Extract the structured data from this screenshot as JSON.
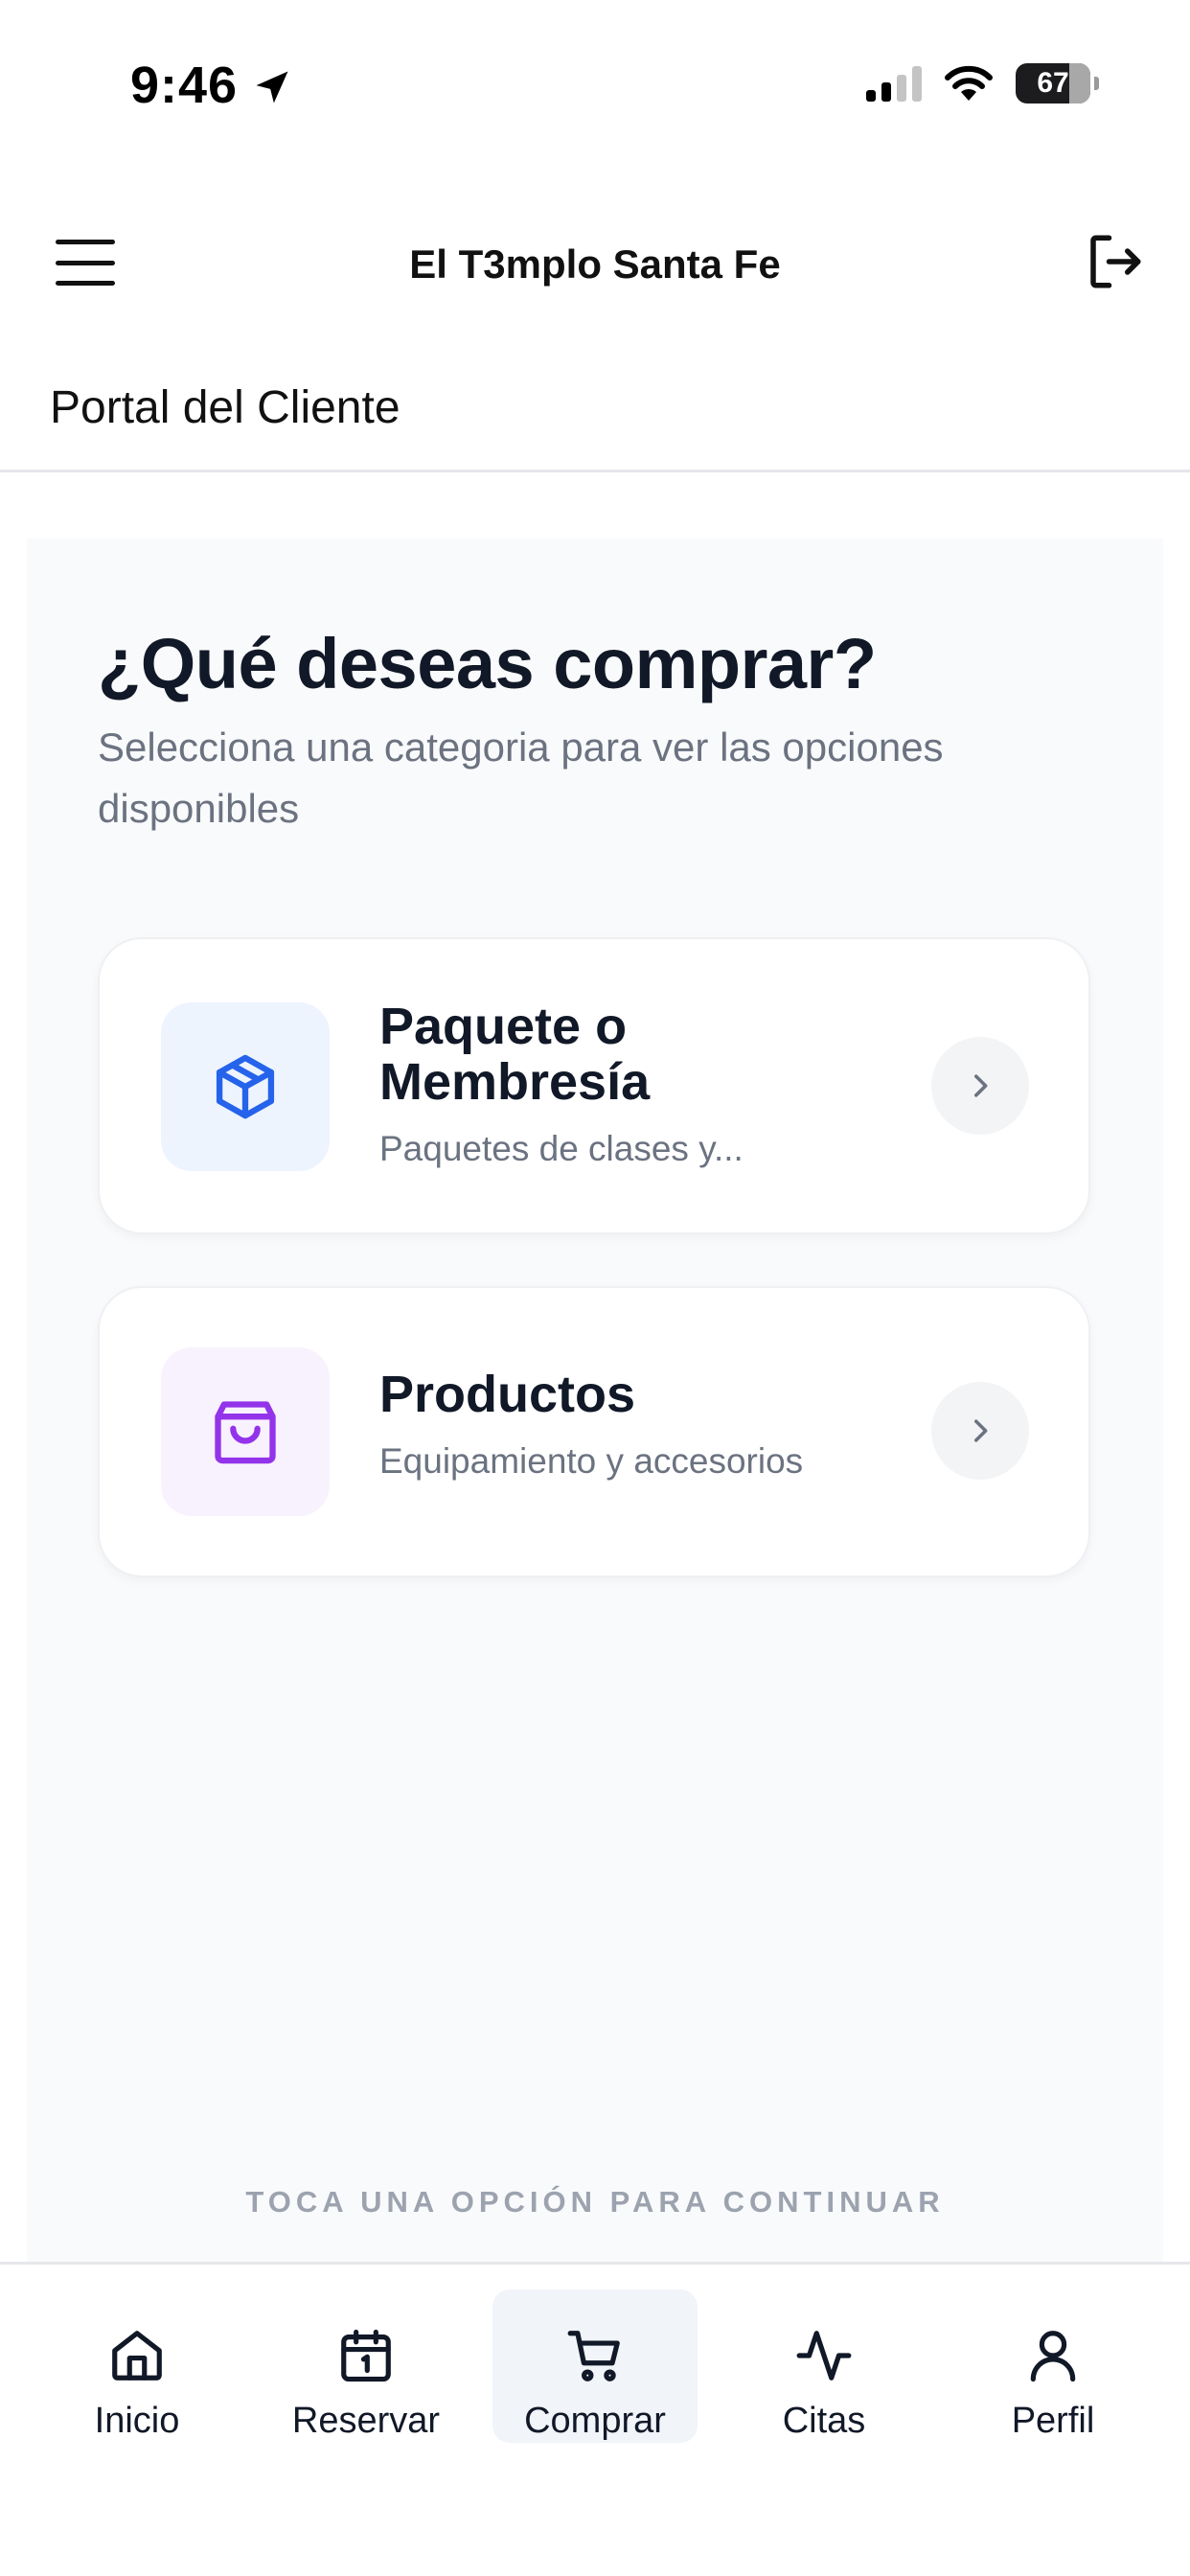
{
  "status_bar": {
    "time": "9:46",
    "battery": "67",
    "location_icon": "location-arrow-icon",
    "signal_icon": "cellular-signal-icon",
    "wifi_icon": "wifi-icon"
  },
  "header": {
    "title": "El T3mplo Santa Fe",
    "menu_icon": "hamburger-menu-icon",
    "logout_icon": "logout-icon"
  },
  "portal_label": "Portal del Cliente",
  "main": {
    "heading": "¿Qué deseas comprar?",
    "subheading": "Selecciona una categoria para ver las opciones disponibles",
    "categories": [
      {
        "title": "Paquete o Membresía",
        "description": "Paquetes de clases y...",
        "icon": "package-box-icon",
        "icon_color": "#2563eb",
        "icon_bg": "#eef4fe"
      },
      {
        "title": "Productos",
        "description": "Equipamiento y accesorios",
        "icon": "shopping-bag-icon",
        "icon_color": "#9333ea",
        "icon_bg": "#f8f2fe"
      }
    ],
    "hint": "TOCA UNA OPCIÓN PARA CONTINUAR"
  },
  "bottom_nav": {
    "active": "Comprar",
    "items": [
      {
        "label": "Inicio",
        "icon": "home-icon"
      },
      {
        "label": "Reservar",
        "icon": "calendar-icon"
      },
      {
        "label": "Comprar",
        "icon": "shopping-cart-icon"
      },
      {
        "label": "Citas",
        "icon": "activity-pulse-icon"
      },
      {
        "label": "Perfil",
        "icon": "user-icon"
      }
    ]
  },
  "colors": {
    "text_primary": "#111827",
    "text_secondary": "#6b7280",
    "panel_bg": "#f9fafb",
    "active_nav_bg": "#f1f4f8"
  }
}
